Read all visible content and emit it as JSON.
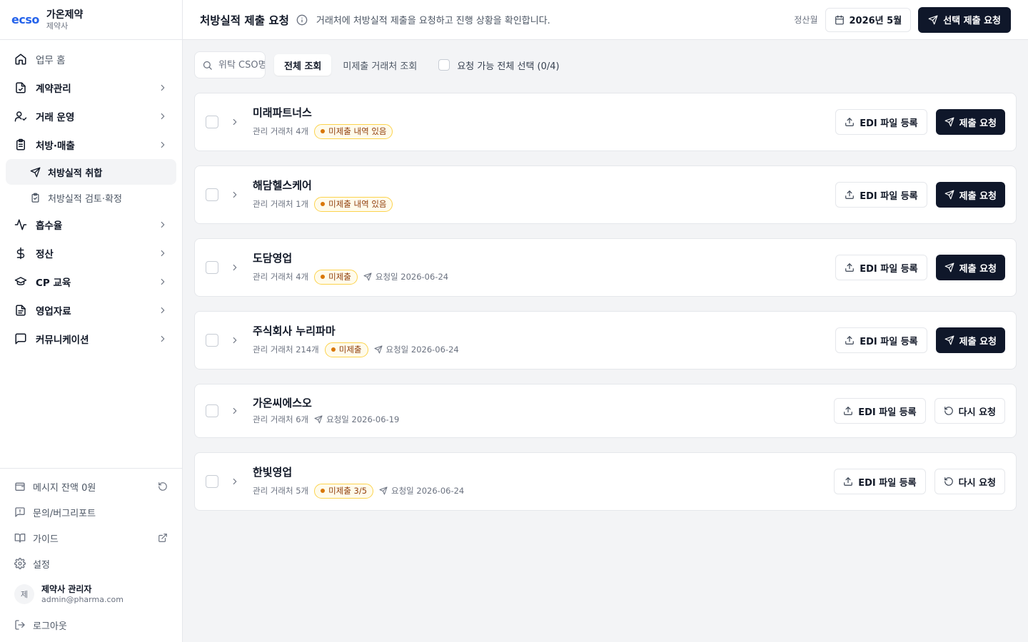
{
  "brand": {
    "logo": "ecso",
    "name": "가온제약",
    "sub": "제약사"
  },
  "nav": {
    "home": "업무 홈",
    "contract": "계약관리",
    "trade": "거래 운영",
    "rx": "처방·매출",
    "rx_collect": "처방실적 취합",
    "rx_review": "처방실적 검토·확정",
    "absorb": "흡수율",
    "settle": "정산",
    "cp": "CP 교육",
    "sales": "영업자료",
    "comm": "커뮤니케이션"
  },
  "bottom": {
    "balance": "메시지 잔액 0원",
    "inquiry": "문의/버그리포트",
    "guide": "가이드",
    "settings": "설정",
    "logout": "로그아웃"
  },
  "user": {
    "avatar": "제",
    "name": "제약사 관리자",
    "email": "admin@pharma.com"
  },
  "header": {
    "title": "처방실적 제출 요청",
    "desc": "거래처에 처방실적 제출을 요청하고 진행 상황을 확인합니다.",
    "period_label": "정산월",
    "period": "2026년 5월",
    "bulk_request": "선택 제출 요청"
  },
  "toolbar": {
    "search_placeholder": "위탁 CSO명",
    "tab_all": "전체 조회",
    "tab_unsubmitted": "미제출 거래처 조회",
    "select_all": "요청 가능 전체 선택 (0/4)"
  },
  "labels": {
    "edi_upload": "EDI 파일 등록",
    "submit_request": "제출 요청",
    "re_request": "다시 요청"
  },
  "cards": [
    {
      "name": "미래파트너스",
      "managed": "관리 거래처 4개",
      "badge": "미제출 내역 있음",
      "date": ""
    },
    {
      "name": "해담헬스케어",
      "managed": "관리 거래처 1개",
      "badge": "미제출 내역 있음",
      "date": ""
    },
    {
      "name": "도담영업",
      "managed": "관리 거래처 4개",
      "badge": "미제출",
      "date": "요청일 2026-06-24"
    },
    {
      "name": "주식회사 누리파마",
      "managed": "관리 거래처 214개",
      "badge": "미제출",
      "date": "요청일 2026-06-24"
    },
    {
      "name": "가온씨에스오",
      "managed": "관리 거래처 6개",
      "badge": "",
      "date": "요청일 2026-06-19"
    },
    {
      "name": "한빛영업",
      "managed": "관리 거래처 5개",
      "badge": "미제출 3/5",
      "date": "요청일 2026-06-24"
    }
  ]
}
